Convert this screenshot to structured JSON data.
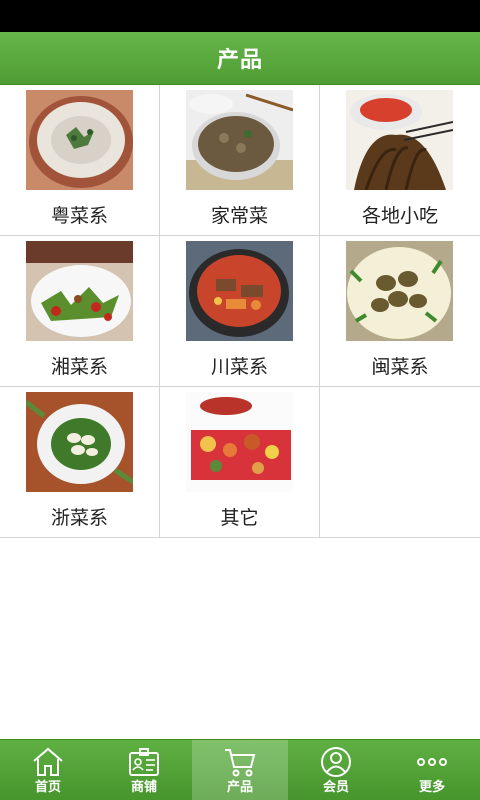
{
  "header": {
    "title": "产品"
  },
  "products": [
    {
      "label": "粤菜系",
      "image": "cantonese-dish-photo"
    },
    {
      "label": "家常菜",
      "image": "home-style-dish-photo"
    },
    {
      "label": "各地小吃",
      "image": "local-snacks-photo"
    },
    {
      "label": "湘菜系",
      "image": "hunan-dish-photo"
    },
    {
      "label": "川菜系",
      "image": "sichuan-dish-photo"
    },
    {
      "label": "闽菜系",
      "image": "fujian-dish-photo"
    },
    {
      "label": "浙菜系",
      "image": "zhejiang-dish-photo"
    },
    {
      "label": "其它",
      "image": "other-dishes-photo"
    }
  ],
  "tabbar": {
    "items": [
      {
        "label": "首页",
        "icon": "home-icon"
      },
      {
        "label": "商铺",
        "icon": "shop-card-icon"
      },
      {
        "label": "产品",
        "icon": "cart-icon",
        "active": true
      },
      {
        "label": "会员",
        "icon": "member-icon"
      },
      {
        "label": "更多",
        "icon": "more-icon"
      }
    ]
  },
  "colors": {
    "header_green": "#5aab3e",
    "tabbar_green": "#4e9c33",
    "divider": "#d5d5d5"
  }
}
